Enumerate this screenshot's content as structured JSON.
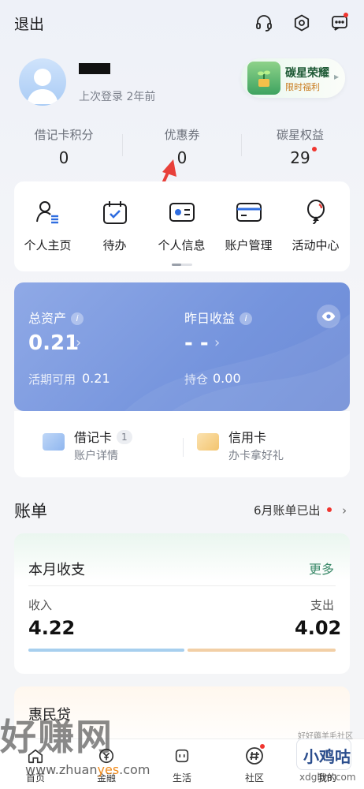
{
  "topbar": {
    "logout": "退出",
    "icons": [
      "headset-icon",
      "settings-hex-icon",
      "message-icon"
    ]
  },
  "profile": {
    "last_login": "上次登录 2年前"
  },
  "honor": {
    "title": "碳星荣耀",
    "subtitle": "限时福利"
  },
  "stats": [
    {
      "label": "借记卡积分",
      "value": "0"
    },
    {
      "label": "优惠券",
      "value": "0"
    },
    {
      "label": "碳星权益",
      "value": "29"
    }
  ],
  "quick_actions": [
    {
      "label": "个人主页",
      "icon": "person-list-icon"
    },
    {
      "label": "待办",
      "icon": "calendar-check-icon"
    },
    {
      "label": "个人信息",
      "icon": "id-card-icon"
    },
    {
      "label": "账户管理",
      "icon": "card-icon"
    },
    {
      "label": "活动中心",
      "icon": "balloon-icon"
    }
  ],
  "assets": {
    "total_label": "总资产",
    "total_value": "0.21",
    "yesterday_label": "昨日收益",
    "yesterday_value": "- -",
    "current_label": "活期可用",
    "current_value": "0.21",
    "holding_label": "持仓",
    "holding_value": "0.00"
  },
  "cards": {
    "debit_title": "借记卡",
    "debit_count": "1",
    "debit_sub": "账户详情",
    "credit_title": "信用卡",
    "credit_sub": "办卡拿好礼"
  },
  "bill": {
    "title": "账单",
    "notice": "6月账单已出",
    "month_title": "本月收支",
    "more": "更多",
    "income_label": "收入",
    "income_value": "4.22",
    "expense_label": "支出",
    "expense_value": "4.02",
    "income_fraction": 0.512
  },
  "loan": {
    "title": "惠民贷"
  },
  "bottom_nav": [
    {
      "label": "首页",
      "icon": "home-icon"
    },
    {
      "label": "金融",
      "icon": "finance-icon"
    },
    {
      "label": "生活",
      "icon": "life-icon"
    },
    {
      "label": "社区",
      "icon": "community-hash-icon"
    },
    {
      "label": "我的",
      "icon": "mine-icon"
    }
  ],
  "watermarks": {
    "left_big": "好赚网",
    "left_url_a": "www.zhuan",
    "left_url_b": "yes",
    "left_url_c": ".com",
    "right_text": "小鸡咕",
    "right_url": "xdgltm.com",
    "right_top": "好好薅羊毛社区"
  },
  "colors": {
    "asset_card": "#7594dd",
    "accent_red": "#f0352f",
    "more_link": "#3c8a6a"
  }
}
